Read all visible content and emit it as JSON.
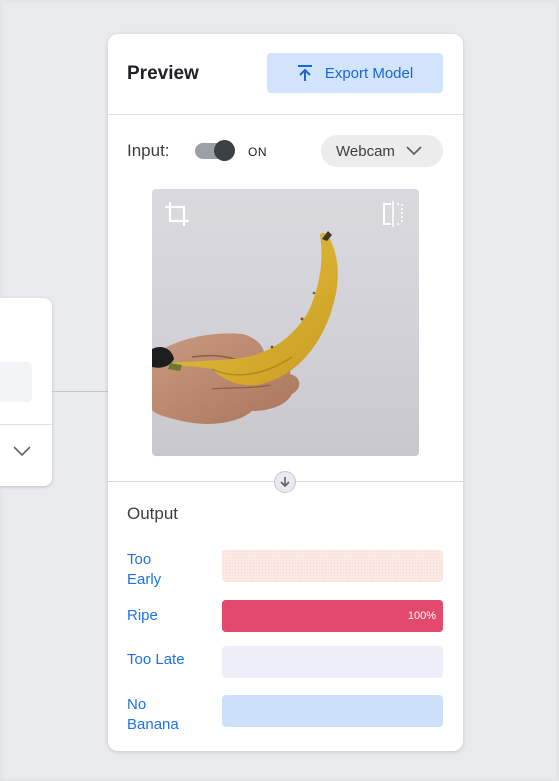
{
  "preview": {
    "title": "Preview",
    "export_label": "Export Model",
    "input_label": "Input:",
    "toggle_state": "ON",
    "source_select": "Webcam"
  },
  "output": {
    "title": "Output",
    "classes": [
      {
        "label": "Too\nEarly",
        "track_color": "#fbe9e3",
        "fill_color": "#fbe9e3",
        "value": 0,
        "value_label": ""
      },
      {
        "label": "Ripe",
        "track_color": "#e2496c",
        "fill_color": "#e2496c",
        "value": 1.0,
        "value_label": "100%"
      },
      {
        "label": "Too Late",
        "track_color": "#eceff7",
        "fill_color": "#eceff7",
        "value": 0,
        "value_label": ""
      },
      {
        "label": "No\nBanana",
        "track_color": "#cde0f9",
        "fill_color": "#cde0f9",
        "value": 0,
        "value_label": ""
      }
    ]
  },
  "icons": {
    "export": "upload-arrow-icon",
    "crop": "crop-icon",
    "flip": "flip-icon",
    "dropdown": "chevron-down-icon",
    "flow": "arrow-down-icon"
  },
  "colors": {
    "accent": "#1a73e8",
    "export_bg": "#d2e3fc",
    "ripe": "#e2496c"
  }
}
